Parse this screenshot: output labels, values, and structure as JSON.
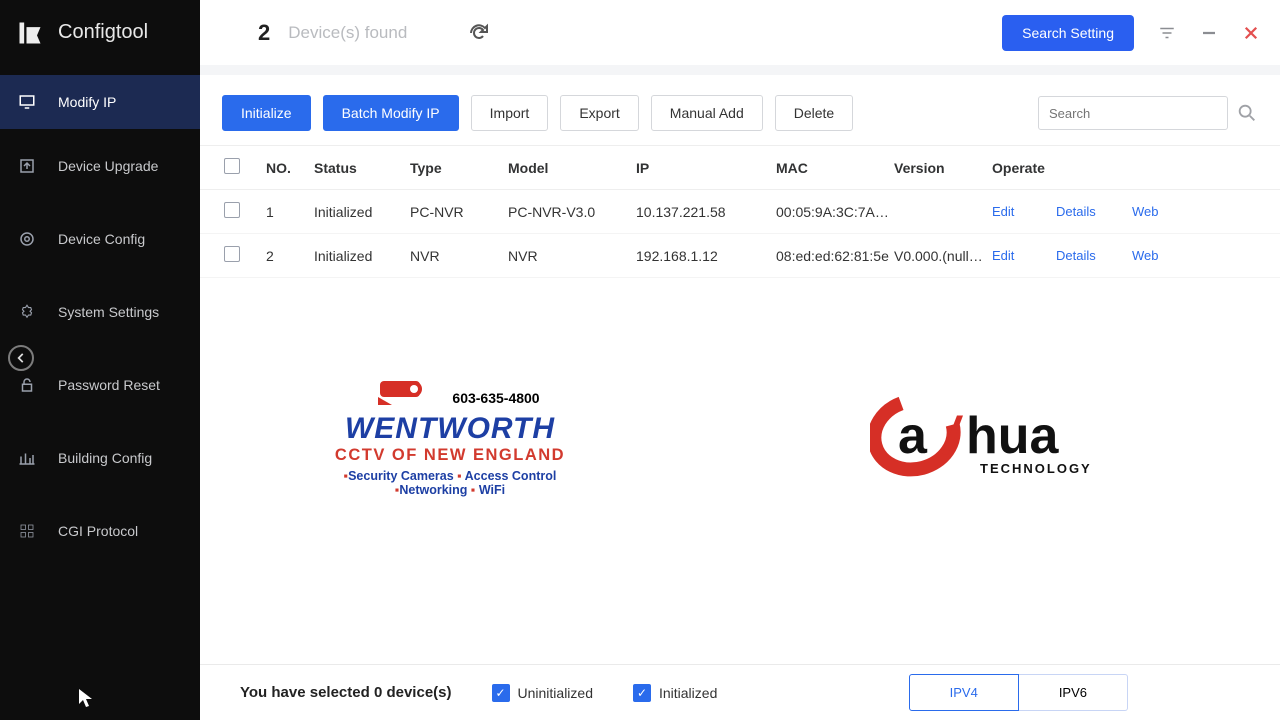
{
  "app": {
    "title": "Configtool"
  },
  "sidebar": {
    "items": [
      {
        "label": "Modify IP"
      },
      {
        "label": "Device Upgrade"
      },
      {
        "label": "Device Config"
      },
      {
        "label": "System Settings"
      },
      {
        "label": "Password Reset"
      },
      {
        "label": "Building Config"
      },
      {
        "label": "CGI Protocol"
      }
    ]
  },
  "topbar": {
    "count": "2",
    "found_label": "Device(s) found",
    "search_setting_label": "Search Setting"
  },
  "toolbar": {
    "initialize": "Initialize",
    "batch_modify_ip": "Batch Modify IP",
    "import": "Import",
    "export": "Export",
    "manual_add": "Manual Add",
    "delete": "Delete",
    "search_placeholder": "Search"
  },
  "table": {
    "headers": {
      "no": "NO.",
      "status": "Status",
      "type": "Type",
      "model": "Model",
      "ip": "IP",
      "mac": "MAC",
      "version": "Version",
      "operate": "Operate"
    },
    "ops": {
      "edit": "Edit",
      "details": "Details",
      "web": "Web"
    },
    "rows": [
      {
        "no": "1",
        "status": "Initialized",
        "type": "PC-NVR",
        "model": "PC-NVR-V3.0",
        "ip": "10.137.221.58",
        "mac": "00:05:9A:3C:7A…",
        "version": ""
      },
      {
        "no": "2",
        "status": "Initialized",
        "type": "NVR",
        "model": "NVR",
        "ip": "192.168.1.12",
        "mac": "08:ed:ed:62:81:5e",
        "version": "V0.000.(null…"
      }
    ]
  },
  "logos": {
    "wentworth": {
      "phone": "603-635-4800",
      "name": "WENTWORTH",
      "sub": "CCTV OF NEW ENGLAND",
      "line1": "Security Cameras",
      "line1b": "Access Control",
      "line2a": "Networking",
      "line2b": "WiFi"
    },
    "dahua": {
      "a": "a",
      "hua": "hua",
      "tech": "TECHNOLOGY"
    }
  },
  "footer": {
    "selected_prefix": "You have selected 0",
    "selected_suffix": "  device(s)",
    "uninitialized": "Uninitialized",
    "initialized": "Initialized",
    "ipv4": "IPV4",
    "ipv6": "IPV6"
  }
}
